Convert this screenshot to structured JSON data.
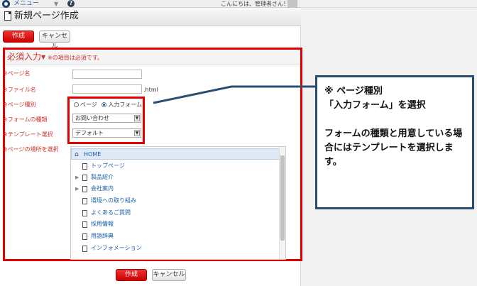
{
  "topbar": {
    "menu_label": "メニュー",
    "help_label": "?",
    "greeting": "こんにちは、管理者さん！"
  },
  "page": {
    "title": "新規ページ作成"
  },
  "actions": {
    "create_label": "作成",
    "cancel_label": "キャンセル"
  },
  "section": {
    "title": "必須入力",
    "note": "※の項目は必須です。"
  },
  "form": {
    "page_name_label": "※ページ名",
    "file_name_label": "※ファイル名",
    "file_suffix": ".html",
    "page_type_label": "※ページ種別",
    "page_type_options": [
      "ページ",
      "入力フォーム"
    ],
    "page_type_selected": "入力フォーム",
    "form_type_label": "※フォームの種類",
    "form_type_value": "お問い合わせ",
    "template_label": "※テンプレート選択",
    "template_value": "デフォルト",
    "location_label": "※ページの場所を選択"
  },
  "tree": {
    "items": [
      {
        "label": "HOME",
        "selected": true
      },
      {
        "label": "トップページ",
        "expandable": false
      },
      {
        "label": "製品紹介",
        "expandable": true
      },
      {
        "label": "会社案内",
        "expandable": true
      },
      {
        "label": "環境への取り組み",
        "expandable": false
      },
      {
        "label": "よくあるご質問",
        "expandable": false
      },
      {
        "label": "採用情報",
        "expandable": false
      },
      {
        "label": "用語辞典",
        "expandable": false
      },
      {
        "label": "インフォメーション",
        "expandable": false
      }
    ]
  },
  "callout": {
    "line1": "※ ページ種別",
    "line2": "「入力フォーム」を選択",
    "body": "フォームの種類と用意している場合にはテンプレートを選択します。"
  },
  "colors": {
    "highlight": "#e00000",
    "callout_border": "#2a4e73",
    "required": "#d0302a",
    "link": "#1a5ea8"
  }
}
